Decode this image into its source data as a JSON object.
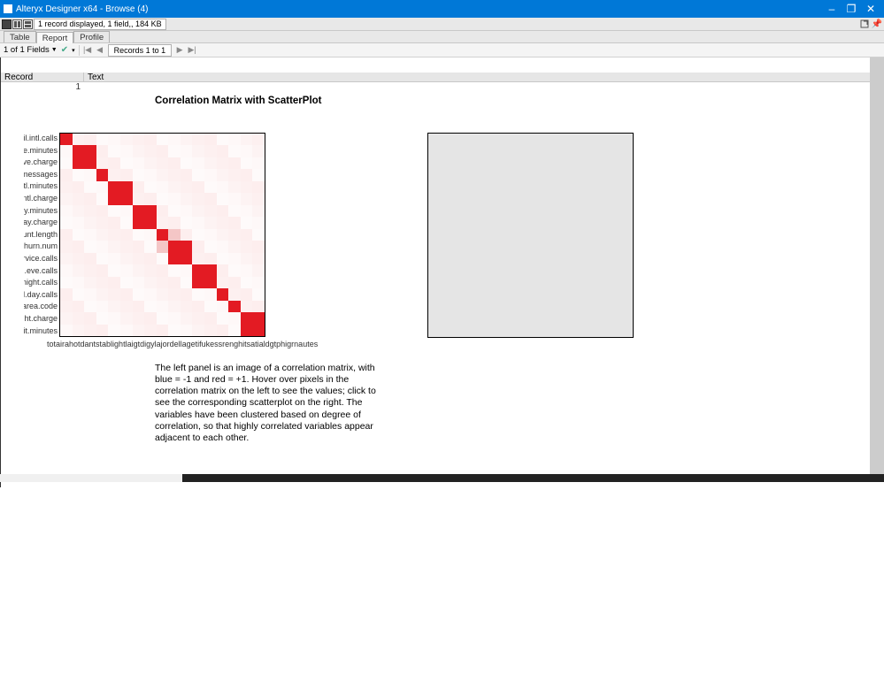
{
  "window": {
    "title": "Alteryx Designer x64 - Browse (4)",
    "minimize": "–",
    "maximize": "❐",
    "close": "✕"
  },
  "toolbar": {
    "info": "1 record displayed, 1 field,, 184 KB"
  },
  "tabs": {
    "table": "Table",
    "report": "Report",
    "profile": "Profile"
  },
  "nav": {
    "fields_label": "1 of 1 Fields",
    "records_label": "Records 1 to 1"
  },
  "grid": {
    "headers": {
      "record": "Record",
      "text": "Text"
    },
    "row1_record": "1"
  },
  "report": {
    "title": "Correlation Matrix with ScatterPlot",
    "y_labels": [
      "il.intl.calls",
      "e.minutes",
      "ve.charge",
      "messages",
      "tl.minutes",
      "intl.charge",
      "y.minutes",
      "ay.charge",
      "unt.length",
      "hurn.num",
      "rvice.calls",
      "l.eve.calls",
      "night.calls",
      "l.day.calls",
      "area.code",
      "ht.charge",
      "it.minutes"
    ],
    "x_label_run": "totairahotdantstablightlaigtdigylajordellagetifukessrenghitsatialdgtphigrnautes",
    "description": "The left panel is an image of a correlation matrix, with blue = -1 and red = +1. Hover over pixels in the correlation matrix on the left to see the values; click to see the corresponding scatterplot on the right. The variables have been clustered based on degree of correlation, so that highly correlated variables appear adjacent to each other."
  },
  "chart_data": {
    "type": "heatmap",
    "title": "Correlation Matrix with ScatterPlot",
    "rows": [
      "il.intl.calls",
      "e.minutes",
      "ve.charge",
      "messages",
      "tl.minutes",
      "intl.charge",
      "y.minutes",
      "ay.charge",
      "unt.length",
      "hurn.num",
      "rvice.calls",
      "l.eve.calls",
      "night.calls",
      "l.day.calls",
      "area.code",
      "ht.charge",
      "it.minutes"
    ],
    "cols": [
      "il.intl.calls",
      "e.minutes",
      "ve.charge",
      "messages",
      "tl.minutes",
      "intl.charge",
      "y.minutes",
      "ay.charge",
      "unt.length",
      "hurn.num",
      "rvice.calls",
      "l.eve.calls",
      "night.calls",
      "l.day.calls",
      "area.code",
      "ht.charge",
      "it.minutes"
    ],
    "color_scale": {
      "-1": "blue",
      "0": "white",
      "+1": "red"
    },
    "notes": "Diagonal = 1.0 (red). Strong red off-diagonal pairs at approx (1,2)/(2,1), (4,5)/(5,4), (6,7)/(7,6), (9,10)/(10,9), (11,12)/(12,11), (15,16)/(16,15). Most other cells ~0 (near white/light pink). Exact numeric values not displayed; chart is clustered so highly correlated variables are adjacent.",
    "diagonal_value": 1.0,
    "high_corr_pairs": [
      [
        "e.minutes",
        "ve.charge"
      ],
      [
        "tl.minutes",
        "intl.charge"
      ],
      [
        "y.minutes",
        "ay.charge"
      ],
      [
        "hurn.num",
        "rvice.calls"
      ],
      [
        "l.eve.calls",
        "night.calls"
      ],
      [
        "ht.charge",
        "it.minutes"
      ]
    ]
  }
}
